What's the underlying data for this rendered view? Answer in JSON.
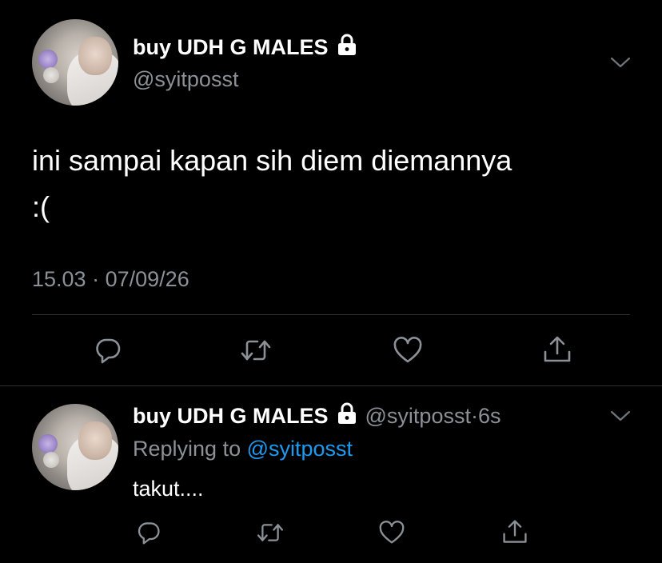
{
  "main_tweet": {
    "display_name": "buy UDH G MALES",
    "handle": "@syitposst",
    "text_line1": "ini sampai kapan sih diem diemannya",
    "text_line2": ":(",
    "time": "15.03",
    "date": "07/09/26",
    "meta_separator": "·",
    "icons": {
      "lock": "lock-icon",
      "menu": "chevron-down-icon",
      "reply": "comment-icon",
      "retweet": "retweet-icon",
      "like": "heart-icon",
      "share": "share-icon"
    }
  },
  "reply_tweet": {
    "display_name": "buy UDH G MALES",
    "handle": "@syitposst",
    "separator": "·",
    "age": "6s",
    "replying_prefix": "Replying to",
    "replying_to": "@syitposst",
    "text": "takut...."
  },
  "colors": {
    "background": "#000000",
    "primary_text": "#ffffff",
    "secondary_text": "#8b9197",
    "link": "#1d9bf0",
    "divider": "#2f3336"
  }
}
